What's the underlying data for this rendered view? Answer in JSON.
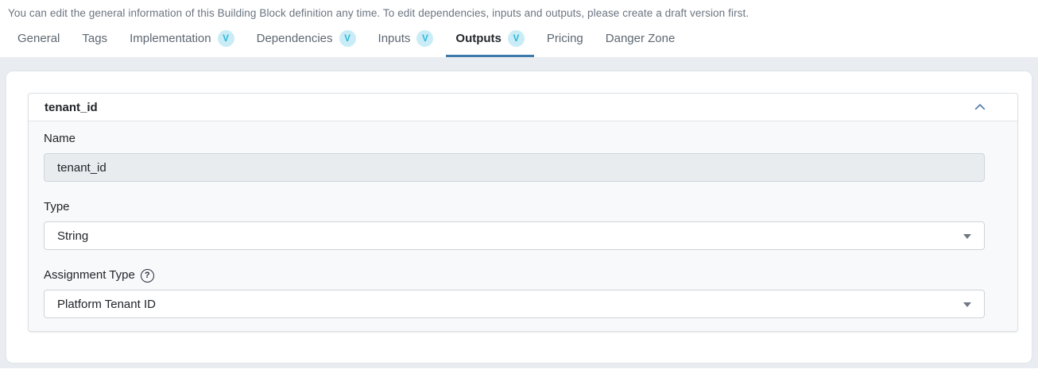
{
  "header": {
    "notice": "You can edit the general information of this Building Block definition any time. To edit dependencies, inputs and outputs, please create a draft version first."
  },
  "tabs": [
    {
      "label": "General",
      "active": false
    },
    {
      "label": "Tags",
      "active": false
    },
    {
      "label": "Implementation",
      "badge": "V",
      "active": false
    },
    {
      "label": "Dependencies",
      "badge": "V",
      "active": false
    },
    {
      "label": "Inputs",
      "badge": "V",
      "active": false
    },
    {
      "label": "Outputs",
      "badge": "V",
      "active": true
    },
    {
      "label": "Pricing",
      "active": false
    },
    {
      "label": "Danger Zone",
      "active": false
    }
  ],
  "panel": {
    "title": "tenant_id",
    "fields": [
      {
        "label": "Name",
        "value": "tenant_id",
        "control": "text-input",
        "state": "disabled"
      },
      {
        "label": "Type",
        "value": "String",
        "control": "select"
      },
      {
        "label": "Assignment Type",
        "value": "Platform Tenant ID",
        "control": "select",
        "help_icon": "question-circle-icon"
      }
    ]
  },
  "icons": {
    "collapse": "chevron-up-icon",
    "select_caret": "caret-down-icon",
    "help_glyph": "?"
  },
  "colors": {
    "page_background": "#e9edf1",
    "active_tab_underline": "#3d7aa9",
    "badge_background": "#c9ecf6",
    "badge_text": "#29b7d9",
    "disabled_input_background": "#e9ecef",
    "chevron": "#5b80ae"
  }
}
